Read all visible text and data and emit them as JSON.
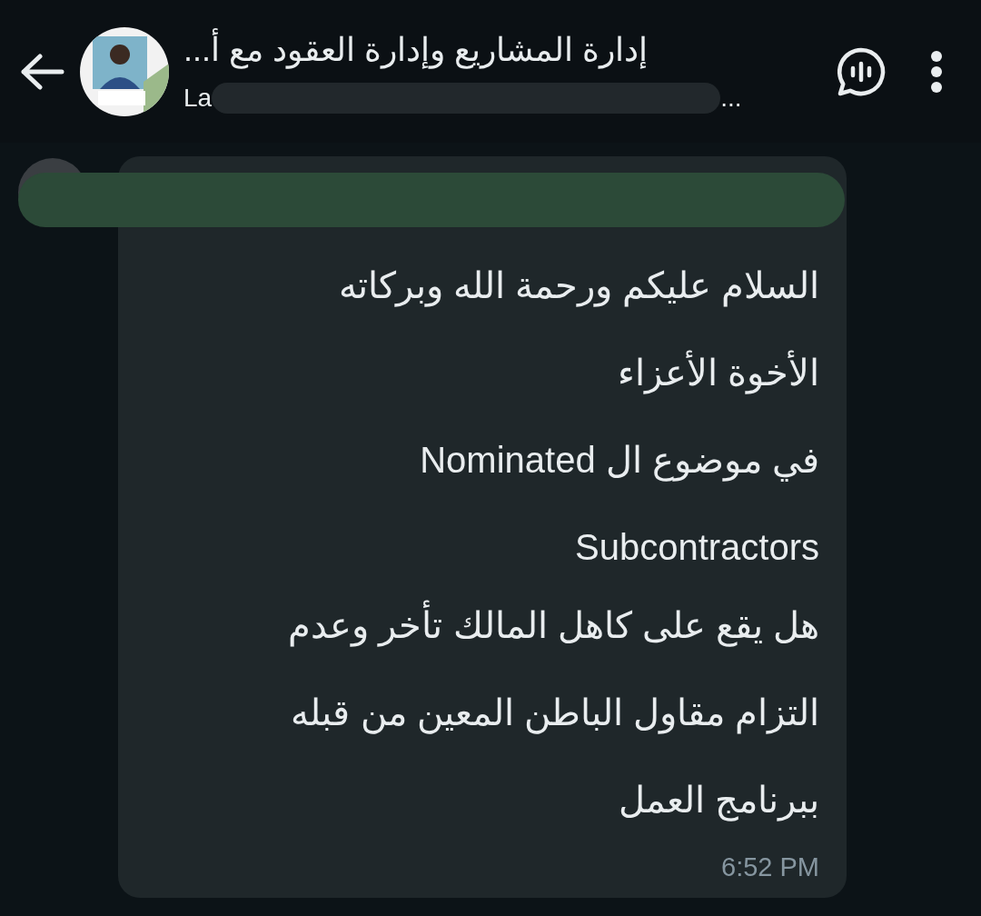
{
  "header": {
    "title": "إدارة المشاريع وإدارة العقود مع أ...",
    "subtitle_start": "La",
    "subtitle_end": "..."
  },
  "message": {
    "lines": [
      "السلام عليكم ورحمة الله وبركاته",
      "الأخوة الأعزاء",
      "في موضوع ال Nominated",
      "Subcontractors",
      "هل يقع على كاهل المالك تأخر وعدم",
      "التزام  مقاول الباطن المعين من قبله",
      "ببرنامج العمل"
    ],
    "time": "6:52 PM"
  }
}
